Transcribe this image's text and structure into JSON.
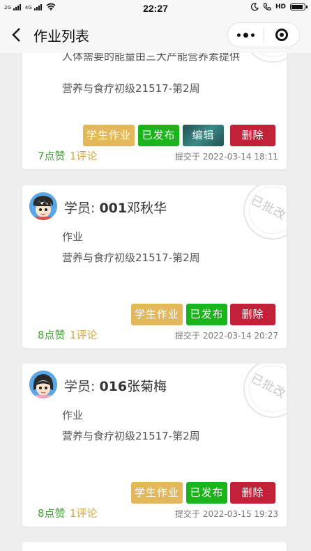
{
  "status_bar": {
    "signal_1": "2G",
    "signal_2": "4G",
    "time": "22:27",
    "hd": "HD"
  },
  "nav": {
    "title": "作业列表"
  },
  "cards": [
    {
      "student_label": "",
      "student_id": "",
      "student_name": "",
      "stamp": "",
      "title": "人体需要的能量由三大产能营养素提供",
      "course": "营养与食疗初级21517-第2周",
      "buttons": {
        "homework": "学生作业",
        "published": "已发布",
        "edit": "编辑",
        "delete": "删除"
      },
      "likes": "7点赞",
      "comments": "1评论",
      "submit_time": "提交于 2022-03-14 18:11"
    },
    {
      "student_label": "学员: ",
      "student_id": "001",
      "student_name": "邓秋华",
      "stamp": "已批改",
      "title": "作业",
      "course": "营养与食疗初级21517-第2周",
      "buttons": {
        "homework": "学生作业",
        "published": "已发布",
        "delete": "删除"
      },
      "likes": "8点赞",
      "comments": "1评论",
      "submit_time": "提交于 2022-03-14 20:27"
    },
    {
      "student_label": "学员: ",
      "student_id": "016",
      "student_name": "张菊梅",
      "stamp": "已批改",
      "title": "作业",
      "course": "营养与食疗初级21517-第2周",
      "buttons": {
        "homework": "学生作业",
        "published": "已发布",
        "delete": "删除"
      },
      "likes": "8点赞",
      "comments": "1评论",
      "submit_time": "提交于 2022-03-15 19:23"
    }
  ],
  "colors": {
    "homework_button": "#e2b85a",
    "published_button": "#1bb51b",
    "edit_button": "#2c6f6f",
    "delete_button": "#c2213a",
    "likes": "#44a335",
    "comments": "#d3a748"
  },
  "icons": {
    "back": "chevron-left-icon",
    "more": "more-dots-icon",
    "close": "miniprogram-close-icon"
  }
}
